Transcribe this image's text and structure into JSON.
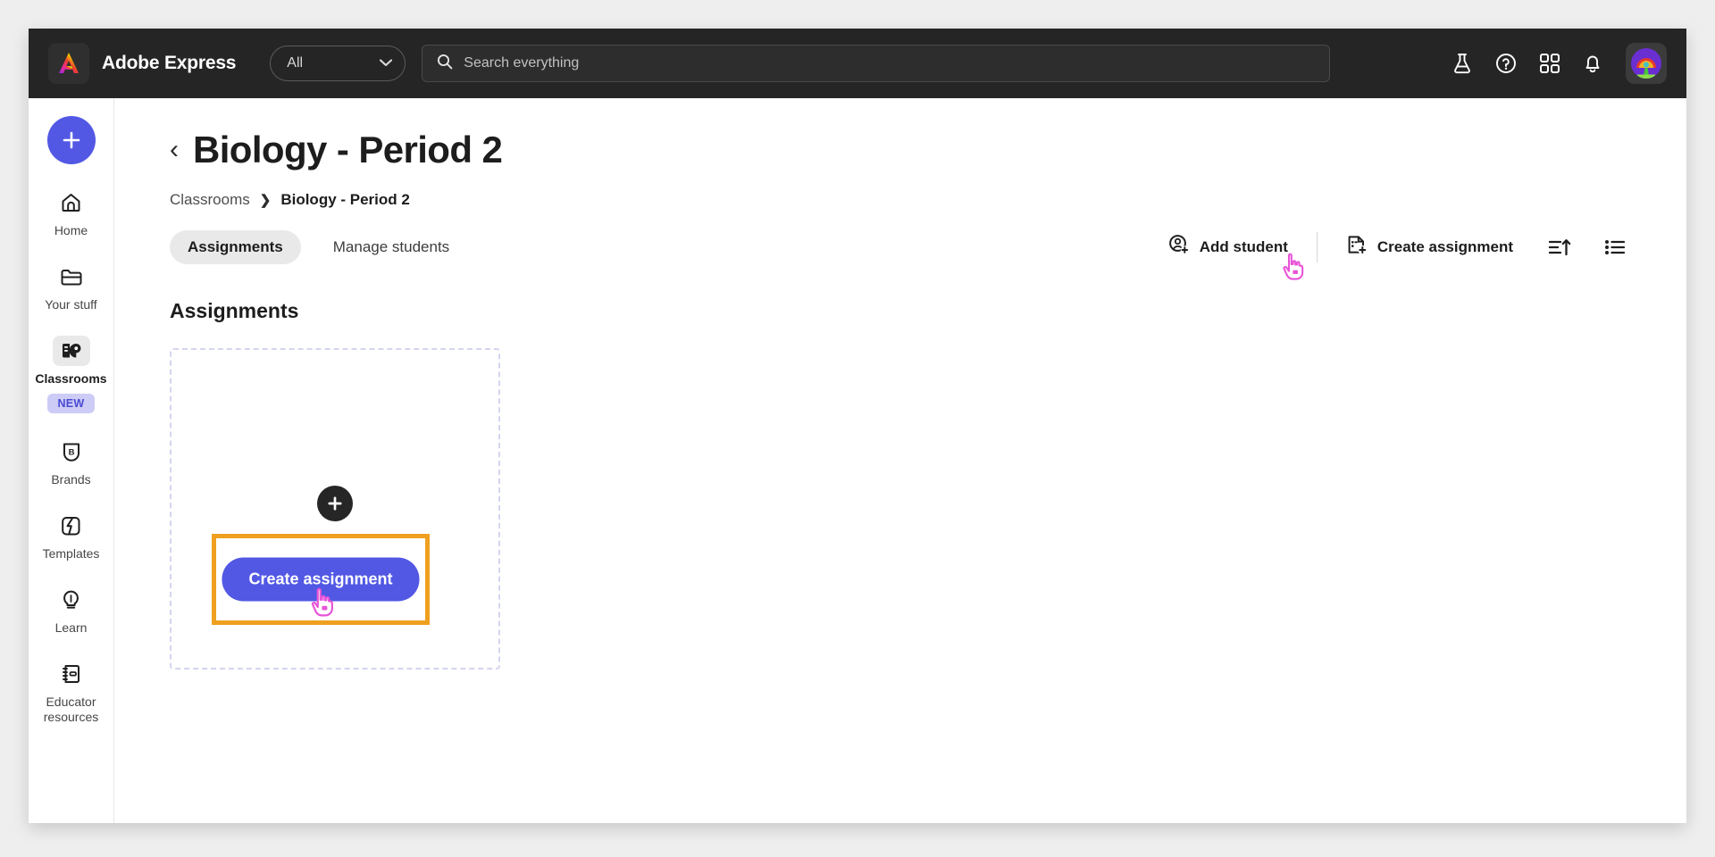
{
  "header": {
    "brand_name": "Adobe Express",
    "logo_icon": "adobe-express-logo",
    "filter_value": "All",
    "filter_chevron_icon": "chevron-down-icon",
    "search_icon": "search-icon",
    "search_placeholder": "Search everything",
    "search_value": "",
    "actions": [
      {
        "icon": "flask-icon",
        "name": "beta-labs-button"
      },
      {
        "icon": "help-circle-icon",
        "name": "help-button"
      },
      {
        "icon": "apps-grid-icon",
        "name": "apps-grid-button"
      },
      {
        "icon": "bell-icon",
        "name": "notifications-button"
      }
    ],
    "avatar_icon": "user-avatar"
  },
  "sidebar": {
    "create_button_icon": "plus-icon",
    "items": [
      {
        "label": "Home",
        "icon": "home-icon",
        "active": false,
        "badge": null
      },
      {
        "label": "Your stuff",
        "icon": "folder-icon",
        "active": false,
        "badge": null
      },
      {
        "label": "Classrooms",
        "icon": "classrooms-icon",
        "active": true,
        "badge": "NEW"
      },
      {
        "label": "Brands",
        "icon": "brand-shield-icon",
        "active": false,
        "badge": null
      },
      {
        "label": "Templates",
        "icon": "templates-icon",
        "active": false,
        "badge": null
      },
      {
        "label": "Learn",
        "icon": "lightbulb-icon",
        "active": false,
        "badge": null
      },
      {
        "label": "Educator resources",
        "icon": "notebook-icon",
        "active": false,
        "badge": null
      }
    ]
  },
  "main": {
    "back_chevron": "‹",
    "page_title": "Biology - Period 2",
    "breadcrumb": {
      "parent": "Classrooms",
      "separator": "❯",
      "current": "Biology - Period 2"
    },
    "tabs": [
      {
        "label": "Assignments",
        "active": true
      },
      {
        "label": "Manage students",
        "active": false
      }
    ],
    "toolbar": {
      "add_student_label": "Add student",
      "add_student_icon": "user-add-icon",
      "create_assignment_label": "Create assignment",
      "create_assignment_icon": "document-add-icon",
      "sort_icon": "sort-ascending-icon",
      "view_icon": "list-view-icon"
    },
    "section_title": "Assignments",
    "dropzone": {
      "plus_icon": "plus-icon",
      "create_button_label": "Create assignment"
    },
    "annotation": {
      "highlight_color": "#efa020",
      "cursor_icon": "pointing-hand-cursor",
      "cursor_color": "#e855d8"
    },
    "colors": {
      "accent": "#5258e4",
      "badge_bg": "#ccccf7",
      "badge_text": "#4a4ad4",
      "topbar_bg": "#252525"
    }
  }
}
